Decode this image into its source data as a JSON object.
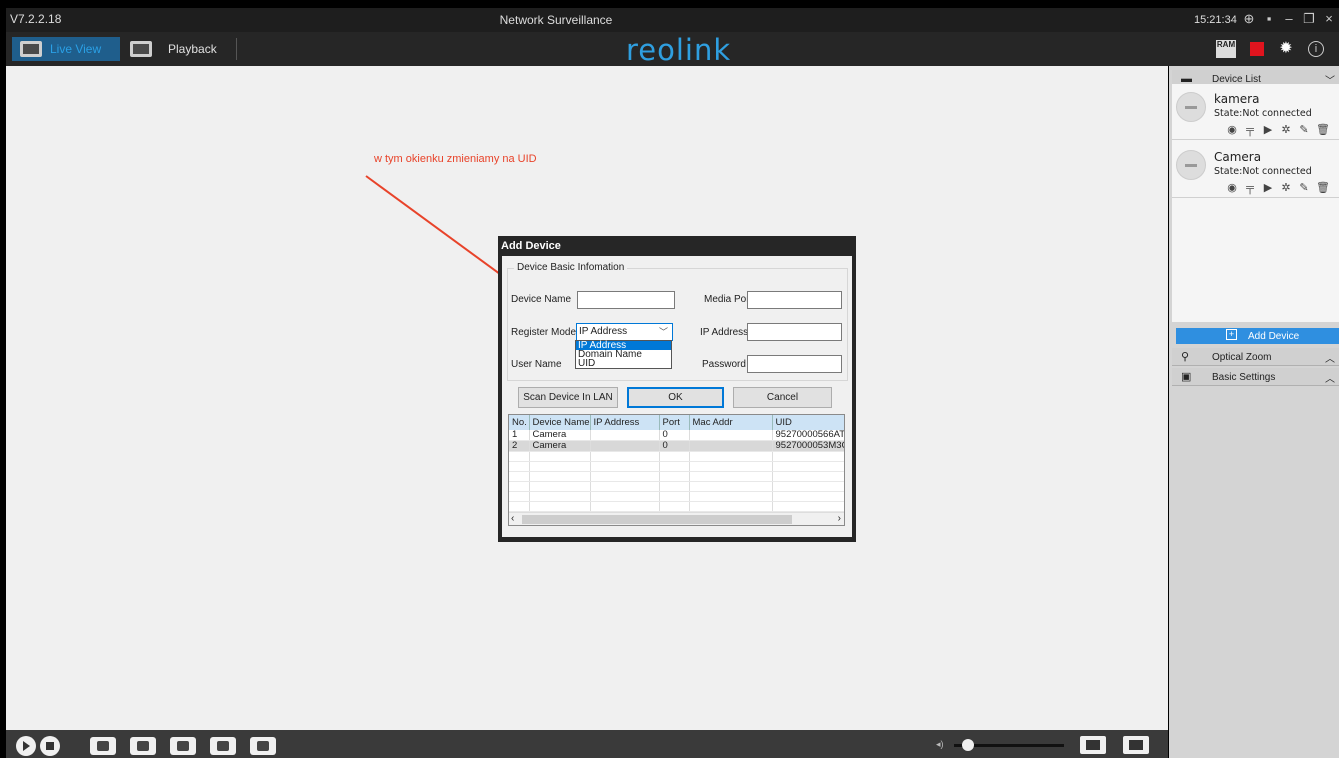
{
  "titlebar": {
    "version": "V7.2.2.18",
    "title": "Network Surveillance",
    "clock": "15:21:34",
    "icons": [
      "network-icon",
      "window-icon",
      "minimize-icon",
      "restore-icon",
      "close-icon"
    ]
  },
  "navbar": {
    "tabs": [
      {
        "label": "Live View",
        "icon": "live-view-icon",
        "active": true
      },
      {
        "label": "Playback",
        "icon": "playback-icon",
        "active": false
      }
    ],
    "logo": "reolink",
    "right_icons": {
      "ram": "RAM",
      "record": "record-icon",
      "settings": "gear-icon",
      "info": "info-icon"
    },
    "accent_color": "#2f9fe0"
  },
  "annotation": {
    "text": "w tym okienku zmieniamy na UID",
    "color": "#e8432a"
  },
  "dialog": {
    "title": "Add Device",
    "group_title": "Device Basic Infomation",
    "fields": {
      "device_name_label": "Device Name",
      "device_name_value": "",
      "media_port_label": "Media Port",
      "media_port_value": "",
      "register_mode_label": "Register Mode",
      "register_mode_value": "IP Address",
      "ip_address_label": "IP Address",
      "ip_address_value": "",
      "user_name_label": "User Name",
      "password_label": "Password",
      "password_value": ""
    },
    "register_mode_options": [
      "IP Address",
      "Domain Name",
      "UID"
    ],
    "buttons": {
      "scan": "Scan Device In LAN",
      "ok": "OK",
      "cancel": "Cancel"
    },
    "table": {
      "columns": [
        "No.",
        "Device Name",
        "IP Address",
        "Port",
        "Mac Addr",
        "UID"
      ],
      "rows": [
        [
          "1",
          "Camera",
          "",
          "0",
          "",
          "95270000566AT7"
        ],
        [
          "2",
          "Camera",
          "",
          "0",
          "",
          "9527000053M3C"
        ]
      ]
    }
  },
  "right_panel": {
    "device_list_title": "Device List",
    "devices": [
      {
        "name": "kamera",
        "state": "State:Not connected"
      },
      {
        "name": "Camera",
        "state": "State:Not connected"
      }
    ],
    "device_actions": [
      "record-icon",
      "ptz-icon",
      "play-icon",
      "settings-icon",
      "edit-icon",
      "delete-icon"
    ],
    "add_device_label": "Add Device",
    "optical_zoom_label": "Optical Zoom",
    "basic_settings_label": "Basic Settings"
  },
  "bottombar": {
    "controls": [
      "play-all-icon",
      "stop-all-icon",
      "snapshot-icon",
      "record-icon",
      "prev-page-icon",
      "next-page-icon",
      "eye-icon"
    ],
    "layout_buttons": [
      "layout-grid-icon",
      "fullscreen-icon"
    ]
  }
}
